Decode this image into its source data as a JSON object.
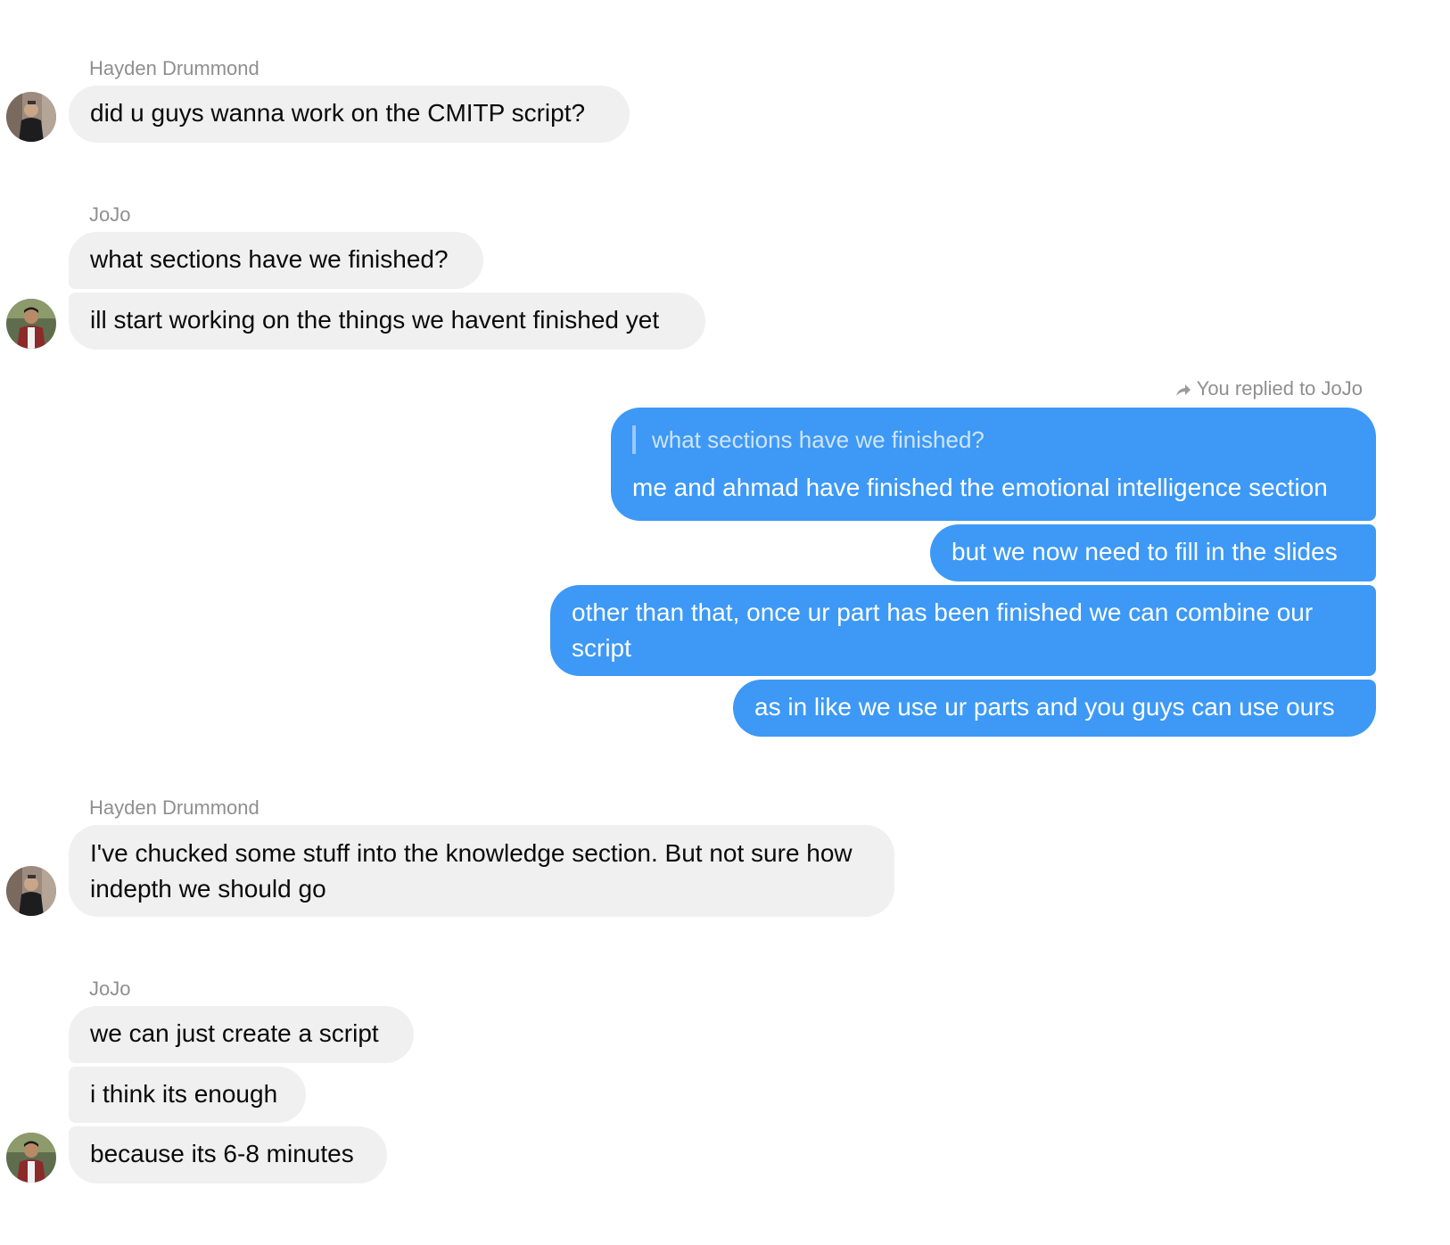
{
  "messages": {
    "group1": {
      "sender": "Hayden Drummond",
      "lines": [
        "did u guys wanna work on the CMITP script?"
      ]
    },
    "group2": {
      "sender": "JoJo",
      "lines": [
        "what sections have we finished?",
        "ill start working on the things we havent finished yet"
      ]
    },
    "group3": {
      "reply_label": "You replied to JoJo",
      "quoted": "what sections have we finished?",
      "lines": [
        "me and ahmad have finished the emotional intelligence section",
        "but we now need to fill in the slides",
        "other than that, once ur part has been finished we can combine our script",
        "as in like we use ur parts and you guys can use ours"
      ]
    },
    "group4": {
      "sender": "Hayden Drummond",
      "lines": [
        "I've chucked some stuff into the knowledge section. But not sure how indepth we should go"
      ]
    },
    "group5": {
      "sender": "JoJo",
      "lines": [
        "we can just create a script",
        "i think its enough",
        "because its 6-8 minutes"
      ]
    }
  },
  "icons": {
    "reply": "reply-arrow-icon",
    "avatar_hayden": "avatar-hayden",
    "avatar_jojo": "avatar-jojo"
  },
  "colors": {
    "outgoing_bubble": "#3d99f5",
    "incoming_bubble": "#f0f0f0",
    "sender_name": "#8f8f8f"
  }
}
